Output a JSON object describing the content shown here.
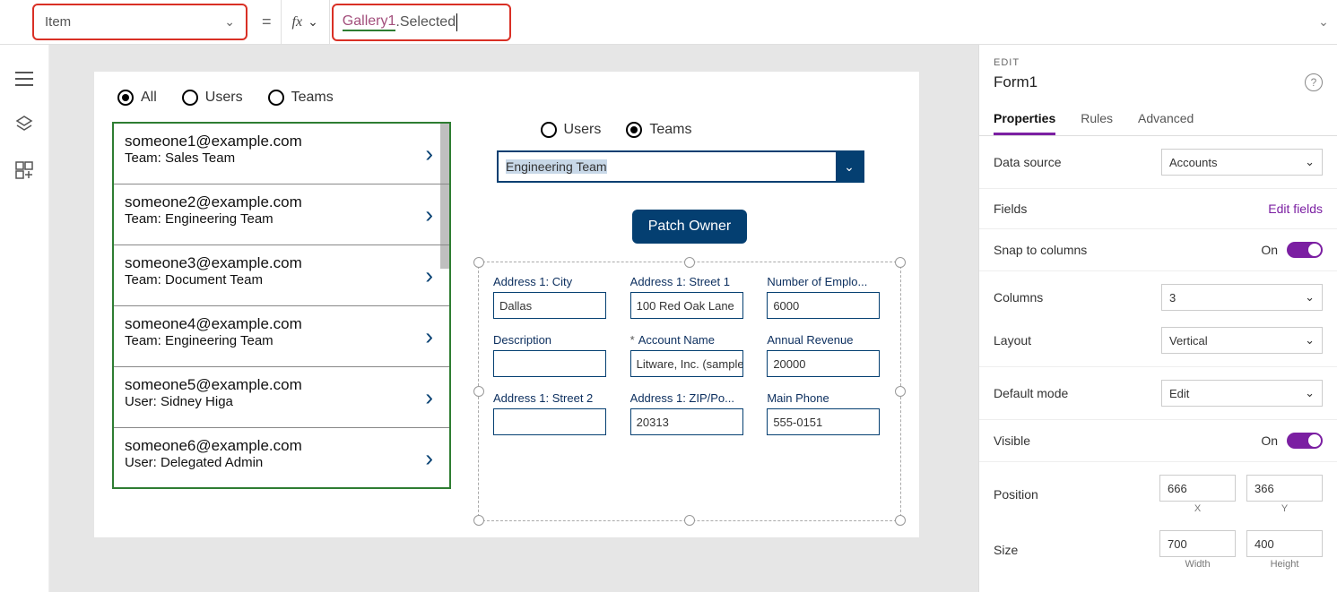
{
  "formula_bar": {
    "property": "Item",
    "fx": "fx",
    "equals": "=",
    "identifier": "Gallery1",
    "selector": ".Selected"
  },
  "canvas": {
    "top_radios": [
      {
        "label": "All",
        "selected": true
      },
      {
        "label": "Users",
        "selected": false
      },
      {
        "label": "Teams",
        "selected": false
      }
    ],
    "gallery": [
      {
        "title": "someone1@example.com",
        "sub": "Team: Sales Team"
      },
      {
        "title": "someone2@example.com",
        "sub": "Team: Engineering Team"
      },
      {
        "title": "someone3@example.com",
        "sub": "Team: Document Team"
      },
      {
        "title": "someone4@example.com",
        "sub": "Team: Engineering Team"
      },
      {
        "title": "someone5@example.com",
        "sub": "User: Sidney Higa"
      },
      {
        "title": "someone6@example.com",
        "sub": "User: Delegated Admin"
      }
    ],
    "right_radios": [
      {
        "label": "Users",
        "selected": false
      },
      {
        "label": "Teams",
        "selected": true
      }
    ],
    "combo_value": "Engineering Team",
    "patch_button": "Patch Owner",
    "form_fields": [
      {
        "label": "Address 1: City",
        "value": "Dallas",
        "required": false
      },
      {
        "label": "Address 1: Street 1",
        "value": "100 Red Oak Lane",
        "required": false
      },
      {
        "label": "Number of Emplo...",
        "value": "6000",
        "required": false
      },
      {
        "label": "Description",
        "value": "",
        "required": false
      },
      {
        "label": "Account Name",
        "value": "Litware, Inc. (sample",
        "required": true
      },
      {
        "label": "Annual Revenue",
        "value": "20000",
        "required": false
      },
      {
        "label": "Address 1: Street 2",
        "value": "",
        "required": false
      },
      {
        "label": "Address 1: ZIP/Po...",
        "value": "20313",
        "required": false
      },
      {
        "label": "Main Phone",
        "value": "555-0151",
        "required": false
      }
    ]
  },
  "props": {
    "section": "EDIT",
    "object_name": "Form1",
    "tabs": [
      {
        "label": "Properties",
        "active": true
      },
      {
        "label": "Rules",
        "active": false
      },
      {
        "label": "Advanced",
        "active": false
      }
    ],
    "data_source_label": "Data source",
    "data_source_value": "Accounts",
    "fields_label": "Fields",
    "edit_fields": "Edit fields",
    "snap_label": "Snap to columns",
    "snap_state": "On",
    "columns_label": "Columns",
    "columns_value": "3",
    "layout_label": "Layout",
    "layout_value": "Vertical",
    "default_mode_label": "Default mode",
    "default_mode_value": "Edit",
    "visible_label": "Visible",
    "visible_state": "On",
    "position_label": "Position",
    "pos_x": "666",
    "pos_y": "366",
    "pos_x_sub": "X",
    "pos_y_sub": "Y",
    "size_label": "Size",
    "size_w": "700",
    "size_h": "400",
    "size_w_sub": "Width",
    "size_h_sub": "Height"
  }
}
